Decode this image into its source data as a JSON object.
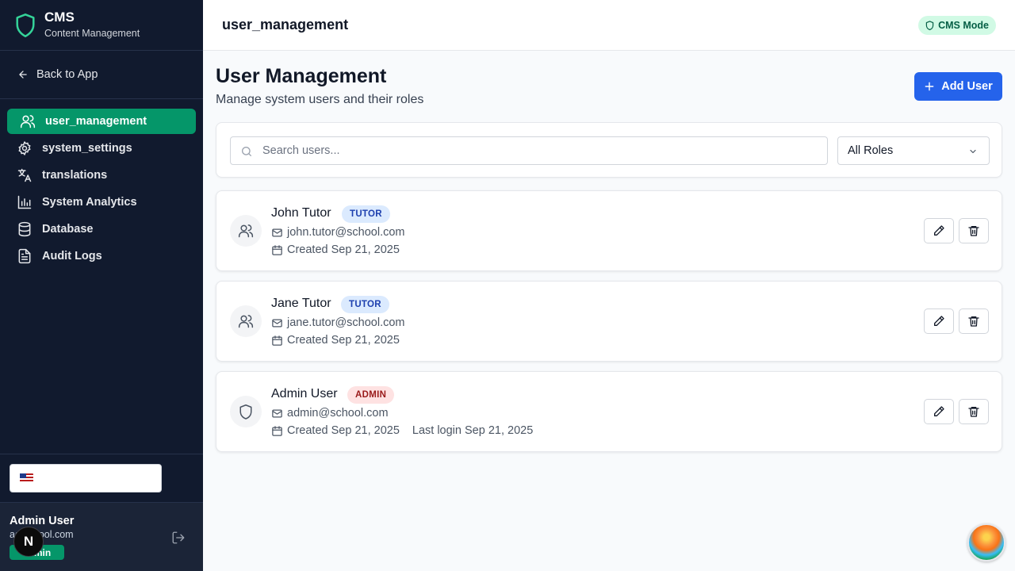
{
  "brand": {
    "title": "CMS",
    "subtitle": "Content Management"
  },
  "back_link": "Back to App",
  "sidebar": {
    "items": [
      {
        "label": "user_management",
        "icon": "users-icon",
        "active": true
      },
      {
        "label": "system_settings",
        "icon": "gear-icon",
        "active": false
      },
      {
        "label": "translations",
        "icon": "translate-icon",
        "active": false
      },
      {
        "label": "System Analytics",
        "icon": "bar-chart-icon",
        "active": false
      },
      {
        "label": "Database",
        "icon": "database-icon",
        "active": false
      },
      {
        "label": "Audit Logs",
        "icon": "file-text-icon",
        "active": false
      }
    ]
  },
  "language_select": {
    "flag": "us-flag-icon",
    "value": ""
  },
  "current_user": {
    "name": "Admin User",
    "email": "admin@school.com",
    "email_visible": "ad   school.com",
    "role": "admin",
    "role_visible": "admin"
  },
  "dev_badge": "N",
  "header": {
    "title": "user_management",
    "mode_badge": "CMS Mode"
  },
  "page": {
    "title": "User Management",
    "subtitle": "Manage system users and their roles",
    "add_button": "Add User"
  },
  "filters": {
    "search_placeholder": "Search users...",
    "search_value": "",
    "role_filter": "All Roles"
  },
  "users": [
    {
      "name": "John Tutor",
      "role": "TUTOR",
      "email": "john.tutor@school.com",
      "created": "Created Sep 21, 2025",
      "last_login": ""
    },
    {
      "name": "Jane Tutor",
      "role": "TUTOR",
      "email": "jane.tutor@school.com",
      "created": "Created Sep 21, 2025",
      "last_login": ""
    },
    {
      "name": "Admin User",
      "role": "ADMIN",
      "email": "admin@school.com",
      "created": "Created Sep 21, 2025",
      "last_login": "Last login Sep 21, 2025"
    }
  ],
  "colors": {
    "sidebar_bg": "#111a2e",
    "active_nav": "#059669",
    "primary": "#2563eb",
    "tutor_badge": "#dbeafe",
    "admin_badge": "#fee2e2"
  }
}
